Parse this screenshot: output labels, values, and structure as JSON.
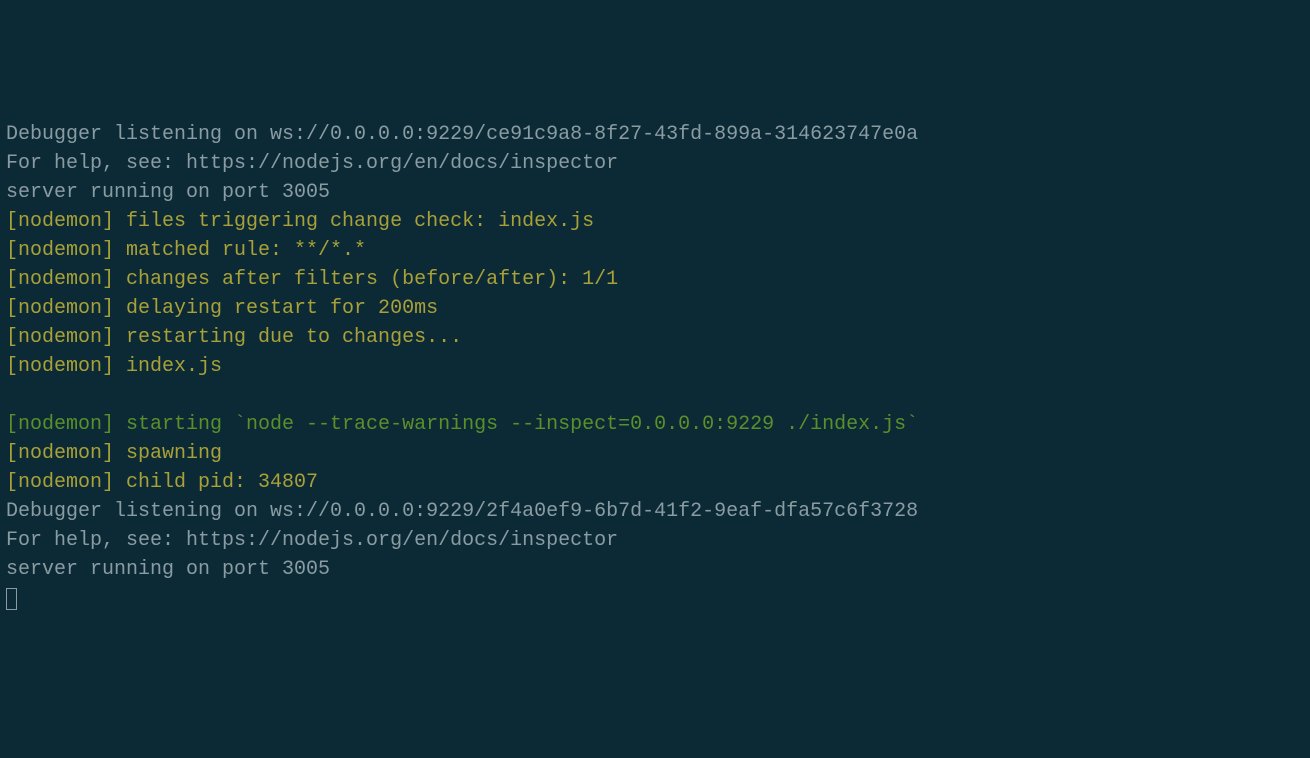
{
  "lines": [
    {
      "text": "Debugger listening on ws://0.0.0.0:9229/ce91c9a8-8f27-43fd-899a-314623747e0a",
      "color": "gray"
    },
    {
      "text": "For help, see: https://nodejs.org/en/docs/inspector",
      "color": "gray"
    },
    {
      "text": "server running on port 3005",
      "color": "gray"
    },
    {
      "text": "[nodemon] files triggering change check: index.js",
      "color": "olive"
    },
    {
      "text": "[nodemon] matched rule: **/*.*",
      "color": "olive"
    },
    {
      "text": "[nodemon] changes after filters (before/after): 1/1",
      "color": "olive"
    },
    {
      "text": "[nodemon] delaying restart for 200ms",
      "color": "olive"
    },
    {
      "text": "[nodemon] restarting due to changes...",
      "color": "olive"
    },
    {
      "text": "[nodemon] index.js",
      "color": "olive"
    },
    {
      "text": " ",
      "color": "gray"
    },
    {
      "text": "[nodemon] starting `node --trace-warnings --inspect=0.0.0.0:9229 ./index.js`",
      "color": "green"
    },
    {
      "text": "[nodemon] spawning",
      "color": "olive"
    },
    {
      "text": "[nodemon] child pid: 34807",
      "color": "olive"
    },
    {
      "text": "Debugger listening on ws://0.0.0.0:9229/2f4a0ef9-6b7d-41f2-9eaf-dfa57c6f3728",
      "color": "gray"
    },
    {
      "text": "For help, see: https://nodejs.org/en/docs/inspector",
      "color": "gray"
    },
    {
      "text": "server running on port 3005",
      "color": "gray"
    }
  ]
}
